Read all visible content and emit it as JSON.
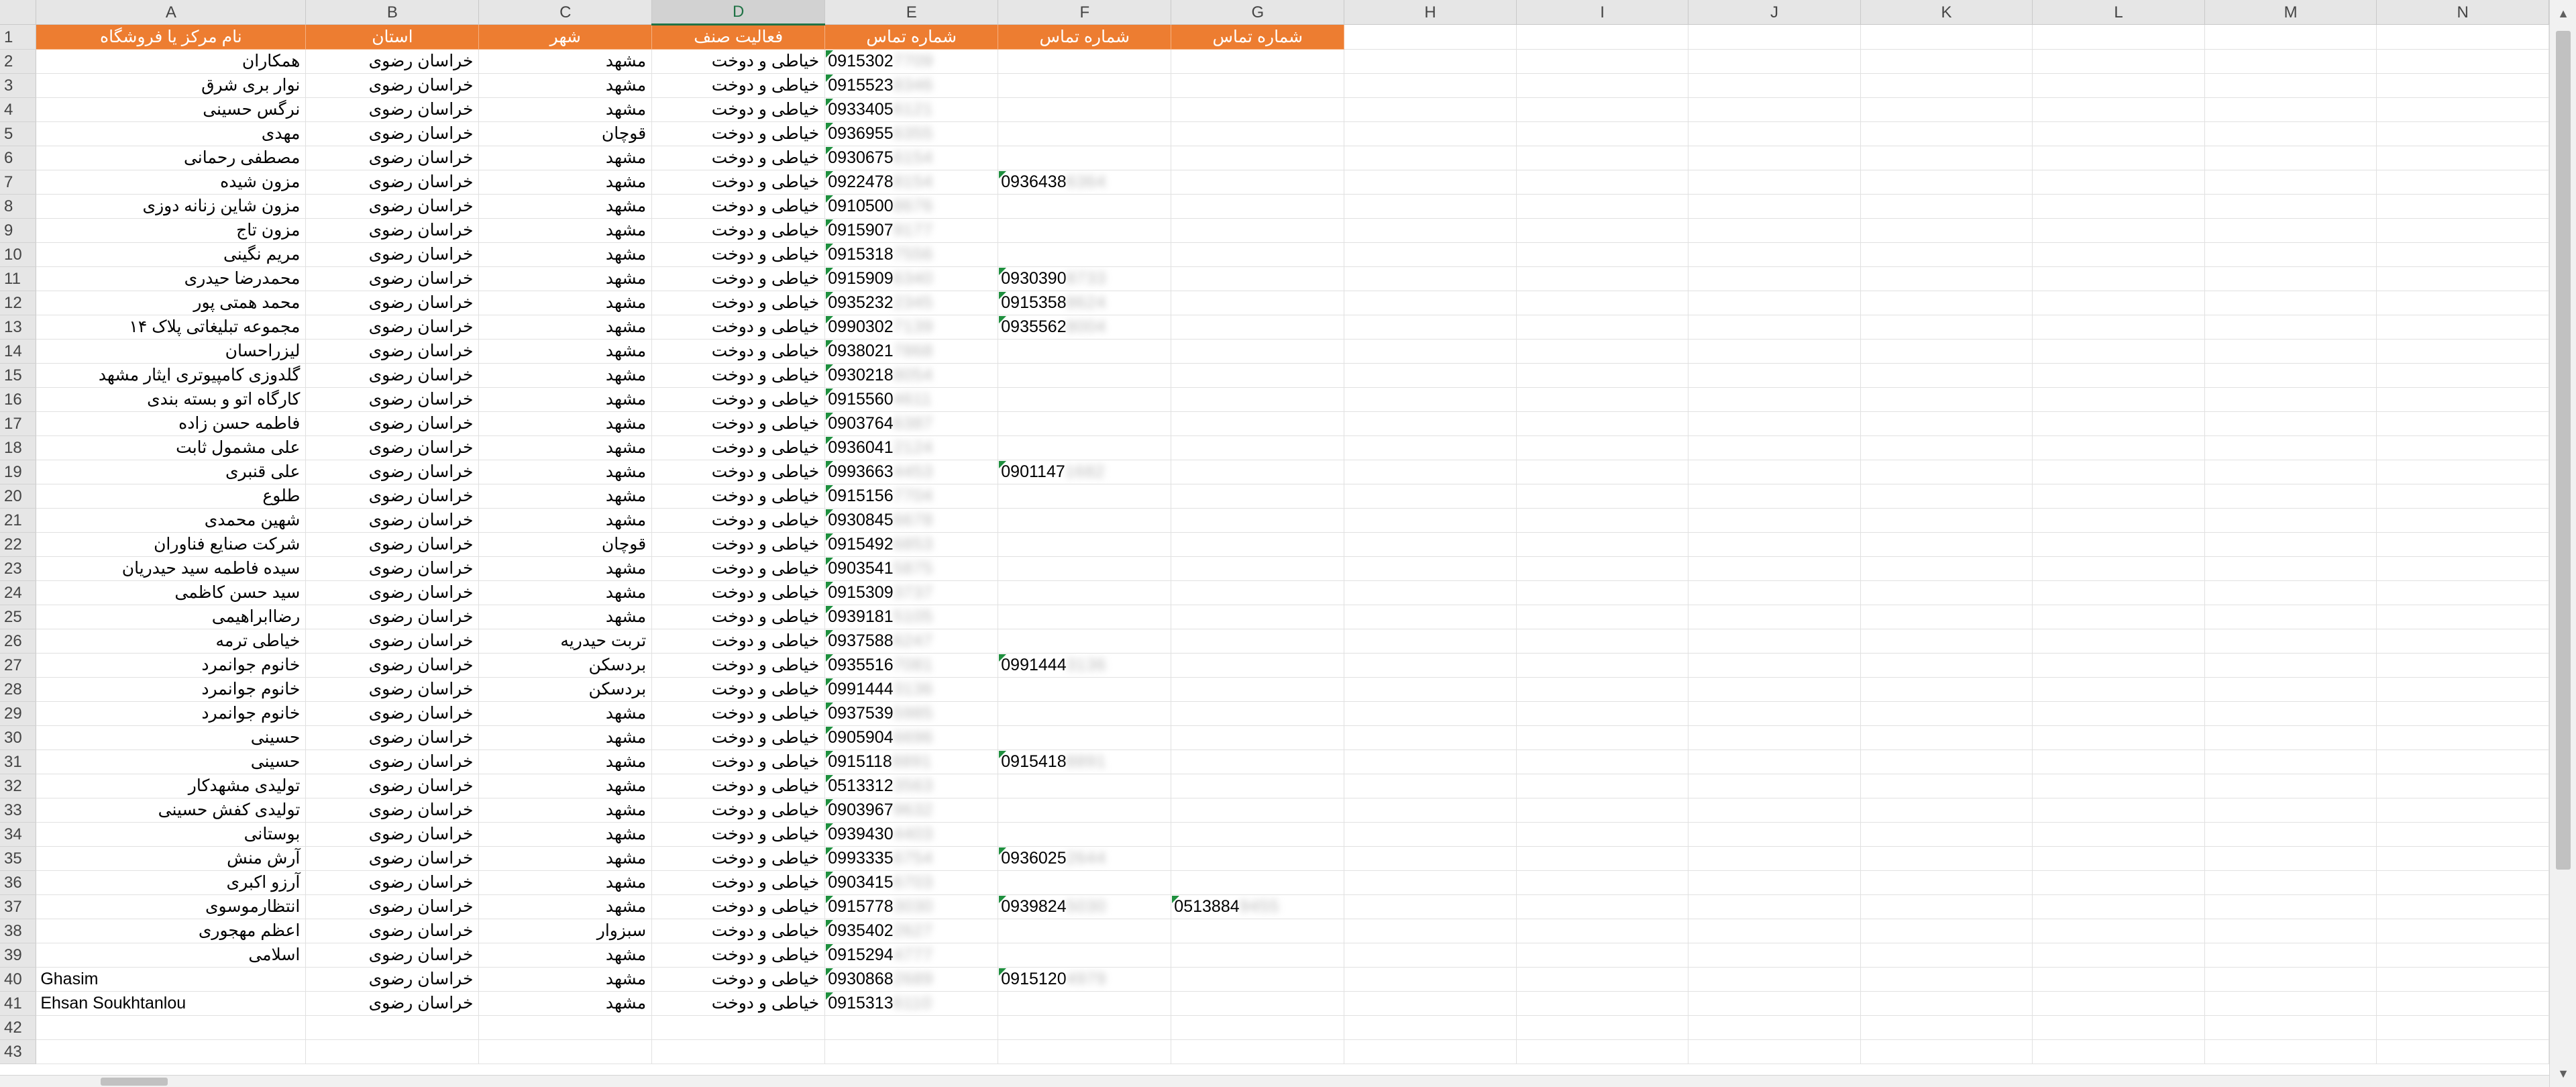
{
  "columns": [
    "A",
    "B",
    "C",
    "D",
    "E",
    "F",
    "G",
    "H",
    "I",
    "J",
    "K",
    "L",
    "M",
    "N"
  ],
  "selected_column": "D",
  "headers": {
    "A": "نام مرکز یا فروشگاه",
    "B": "استان",
    "C": "شهر",
    "D": "فعالیت صنف",
    "E": "شماره تماس",
    "F": "شماره تماس",
    "G": "شماره تماس"
  },
  "row_numbers": [
    "1",
    "2",
    "3",
    "4",
    "5",
    "6",
    "7",
    "8",
    "9",
    "10",
    "11",
    "12",
    "13",
    "14",
    "15",
    "16",
    "17",
    "18",
    "19",
    "20",
    "21",
    "22",
    "23",
    "24",
    "25",
    "26",
    "27",
    "28",
    "29",
    "30",
    "31",
    "32",
    "33",
    "34",
    "35",
    "36",
    "37",
    "38",
    "39",
    "40",
    "41",
    "42",
    "43"
  ],
  "rows": [
    {
      "name": "همکاران",
      "province": "خراسان رضوی",
      "city": "مشهد",
      "activity": "خیاطی و دوخت",
      "e": "0915302",
      "e_hidden": "7709",
      "f": "",
      "f_hidden": "",
      "g": "",
      "g_hidden": ""
    },
    {
      "name": "نوار بری شرق",
      "province": "خراسان رضوی",
      "city": "مشهد",
      "activity": "خیاطی و دوخت",
      "e": "0915523",
      "e_hidden": "8346",
      "f": "",
      "f_hidden": "",
      "g": "",
      "g_hidden": ""
    },
    {
      "name": "نرگس حسینی",
      "province": "خراسان رضوی",
      "city": "مشهد",
      "activity": "خیاطی و دوخت",
      "e": "0933405",
      "e_hidden": "6121",
      "f": "",
      "f_hidden": "",
      "g": "",
      "g_hidden": ""
    },
    {
      "name": "مهدی",
      "province": "خراسان رضوی",
      "city": "قوچان",
      "activity": "خیاطی و دوخت",
      "e": "0936955",
      "e_hidden": "6355",
      "f": "",
      "f_hidden": "",
      "g": "",
      "g_hidden": ""
    },
    {
      "name": "مصطفی رحمانی",
      "province": "خراسان رضوی",
      "city": "مشهد",
      "activity": "خیاطی و دوخت",
      "e": "0930675",
      "e_hidden": "6154",
      "f": "",
      "f_hidden": "",
      "g": "",
      "g_hidden": ""
    },
    {
      "name": "مزون شیده",
      "province": "خراسان رضوی",
      "city": "مشهد",
      "activity": "خیاطی و دوخت",
      "e": "0922478",
      "e_hidden": "8154",
      "f": "0936438",
      "f_hidden": "6364",
      "g": "",
      "g_hidden": ""
    },
    {
      "name": "مزون شاین زنانه دوزی",
      "province": "خراسان رضوی",
      "city": "مشهد",
      "activity": "خیاطی و دوخت",
      "e": "0910500",
      "e_hidden": "8676",
      "f": "",
      "f_hidden": "",
      "g": "",
      "g_hidden": ""
    },
    {
      "name": "مزون تاج",
      "province": "خراسان رضوی",
      "city": "مشهد",
      "activity": "خیاطی و دوخت",
      "e": "0915907",
      "e_hidden": "9177",
      "f": "",
      "f_hidden": "",
      "g": "",
      "g_hidden": ""
    },
    {
      "name": "مریم نگینی",
      "province": "خراسان رضوی",
      "city": "مشهد",
      "activity": "خیاطی و دوخت",
      "e": "0915318",
      "e_hidden": "7556",
      "f": "",
      "f_hidden": "",
      "g": "",
      "g_hidden": ""
    },
    {
      "name": "محمدرضا حیدری",
      "province": "خراسان رضوی",
      "city": "مشهد",
      "activity": "خیاطی و دوخت",
      "e": "0915909",
      "e_hidden": "6340",
      "f": "0930390",
      "f_hidden": "8733",
      "g": "",
      "g_hidden": ""
    },
    {
      "name": "محمد همتی پور",
      "province": "خراسان رضوی",
      "city": "مشهد",
      "activity": "خیاطی و دوخت",
      "e": "0935232",
      "e_hidden": "2345",
      "f": "0915358",
      "f_hidden": "8624",
      "g": "",
      "g_hidden": ""
    },
    {
      "name": "مجموعه تبلیغاتی پلاک ۱۴",
      "province": "خراسان رضوی",
      "city": "مشهد",
      "activity": "خیاطی و دوخت",
      "e": "0990302",
      "e_hidden": "7139",
      "f": "0935562",
      "f_hidden": "8004",
      "g": "",
      "g_hidden": ""
    },
    {
      "name": "لیزراحسان",
      "province": "خراسان رضوی",
      "city": "مشهد",
      "activity": "خیاطی و دوخت",
      "e": "0938021",
      "e_hidden": "7868",
      "f": "",
      "f_hidden": "",
      "g": "",
      "g_hidden": ""
    },
    {
      "name": "گلدوزی کامپیوتری ایثار مشهد",
      "province": "خراسان رضوی",
      "city": "مشهد",
      "activity": "خیاطی و دوخت",
      "e": "0930218",
      "e_hidden": "8054",
      "f": "",
      "f_hidden": "",
      "g": "",
      "g_hidden": ""
    },
    {
      "name": "کارگاه اتو و بسته بندی",
      "province": "خراسان رضوی",
      "city": "مشهد",
      "activity": "خیاطی و دوخت",
      "e": "0915560",
      "e_hidden": "4611",
      "f": "",
      "f_hidden": "",
      "g": "",
      "g_hidden": ""
    },
    {
      "name": "فاطمه حسن زاده",
      "province": "خراسان رضوی",
      "city": "مشهد",
      "activity": "خیاطی و دوخت",
      "e": "0903764",
      "e_hidden": "6387",
      "f": "",
      "f_hidden": "",
      "g": "",
      "g_hidden": ""
    },
    {
      "name": "علی مشمول ثابت",
      "province": "خراسان رضوی",
      "city": "مشهد",
      "activity": "خیاطی و دوخت",
      "e": "0936041",
      "e_hidden": "2124",
      "f": "",
      "f_hidden": "",
      "g": "",
      "g_hidden": ""
    },
    {
      "name": "علی قنبری",
      "province": "خراسان رضوی",
      "city": "مشهد",
      "activity": "خیاطی و دوخت",
      "e": "0993663",
      "e_hidden": "4453",
      "f": "0901147",
      "f_hidden": "1682",
      "g": "",
      "g_hidden": ""
    },
    {
      "name": "طلوع",
      "province": "خراسان رضوی",
      "city": "مشهد",
      "activity": "خیاطی و دوخت",
      "e": "0915156",
      "e_hidden": "7704",
      "f": "",
      "f_hidden": "",
      "g": "",
      "g_hidden": ""
    },
    {
      "name": "شهین محمدی",
      "province": "خراسان رضوی",
      "city": "مشهد",
      "activity": "خیاطی و دوخت",
      "e": "0930845",
      "e_hidden": "6678",
      "f": "",
      "f_hidden": "",
      "g": "",
      "g_hidden": ""
    },
    {
      "name": "شرکت صنایع فناوران",
      "province": "خراسان رضوی",
      "city": "قوچان",
      "activity": "خیاطی و دوخت",
      "e": "0915492",
      "e_hidden": "6853",
      "f": "",
      "f_hidden": "",
      "g": "",
      "g_hidden": ""
    },
    {
      "name": "سیده فاطمه سید حیدریان",
      "province": "خراسان رضوی",
      "city": "مشهد",
      "activity": "خیاطی و دوخت",
      "e": "0903541",
      "e_hidden": "5875",
      "f": "",
      "f_hidden": "",
      "g": "",
      "g_hidden": ""
    },
    {
      "name": "سید حسن کاظمی",
      "province": "خراسان رضوی",
      "city": "مشهد",
      "activity": "خیاطی و دوخت",
      "e": "0915309",
      "e_hidden": "3737",
      "f": "",
      "f_hidden": "",
      "g": "",
      "g_hidden": ""
    },
    {
      "name": "رضاابراهیمی",
      "province": "خراسان رضوی",
      "city": "مشهد",
      "activity": "خیاطی و دوخت",
      "e": "0939181",
      "e_hidden": "5105",
      "f": "",
      "f_hidden": "",
      "g": "",
      "g_hidden": ""
    },
    {
      "name": "خیاطی ترمه",
      "province": "خراسان رضوی",
      "city": "تربت حیدریه",
      "activity": "خیاطی و دوخت",
      "e": "0937588",
      "e_hidden": "6247",
      "f": "",
      "f_hidden": "",
      "g": "",
      "g_hidden": ""
    },
    {
      "name": "خانوم جوانمرد",
      "province": "خراسان رضوی",
      "city": "بردسکن",
      "activity": "خیاطی و دوخت",
      "e": "0935516",
      "e_hidden": "7081",
      "f": "0991444",
      "f_hidden": "3136",
      "g": "",
      "g_hidden": ""
    },
    {
      "name": "خانوم جوانمرد",
      "province": "خراسان رضوی",
      "city": "بردسکن",
      "activity": "خیاطی و دوخت",
      "e": "0991444",
      "e_hidden": "3136",
      "f": "",
      "f_hidden": "",
      "g": "",
      "g_hidden": ""
    },
    {
      "name": "خانوم جوانمرد",
      "province": "خراسان رضوی",
      "city": "مشهد",
      "activity": "خیاطی و دوخت",
      "e": "0937539",
      "e_hidden": "5985",
      "f": "",
      "f_hidden": "",
      "g": "",
      "g_hidden": ""
    },
    {
      "name": "حسینی",
      "province": "خراسان رضوی",
      "city": "مشهد",
      "activity": "خیاطی و دوخت",
      "e": "0905904",
      "e_hidden": "6696",
      "f": "",
      "f_hidden": "",
      "g": "",
      "g_hidden": ""
    },
    {
      "name": "حسینی",
      "province": "خراسان رضوی",
      "city": "مشهد",
      "activity": "خیاطی و دوخت",
      "e": "0915118",
      "e_hidden": "8891",
      "f": "0915418",
      "f_hidden": "8891",
      "g": "",
      "g_hidden": ""
    },
    {
      "name": "تولیدی مشهدکار",
      "province": "خراسان رضوی",
      "city": "مشهد",
      "activity": "خیاطی و دوخت",
      "e": "0513312",
      "e_hidden": "3563",
      "f": "",
      "f_hidden": "",
      "g": "",
      "g_hidden": ""
    },
    {
      "name": "تولیدی کفش حسینی",
      "province": "خراسان رضوی",
      "city": "مشهد",
      "activity": "خیاطی و دوخت",
      "e": "0903967",
      "e_hidden": "9632",
      "f": "",
      "f_hidden": "",
      "g": "",
      "g_hidden": ""
    },
    {
      "name": "بوستانی",
      "province": "خراسان رضوی",
      "city": "مشهد",
      "activity": "خیاطی و دوخت",
      "e": "0939430",
      "e_hidden": "4403",
      "f": "",
      "f_hidden": "",
      "g": "",
      "g_hidden": ""
    },
    {
      "name": "آرش منش",
      "province": "خراسان رضوی",
      "city": "مشهد",
      "activity": "خیاطی و دوخت",
      "e": "0993335",
      "e_hidden": "6754",
      "f": "0936025",
      "f_hidden": "2644",
      "g": "",
      "g_hidden": ""
    },
    {
      "name": "آرزو اکبری",
      "province": "خراسان رضوی",
      "city": "مشهد",
      "activity": "خیاطی و دوخت",
      "e": "0903415",
      "e_hidden": "6703",
      "f": "",
      "f_hidden": "",
      "g": "",
      "g_hidden": ""
    },
    {
      "name": "انتظارموسوی",
      "province": "خراسان رضوی",
      "city": "مشهد",
      "activity": "خیاطی و دوخت",
      "e": "0915778",
      "e_hidden": "3030",
      "f": "0939824",
      "f_hidden": "5030",
      "g": "0513884",
      "g_hidden": "9455"
    },
    {
      "name": "اعظم مهجوری",
      "province": "خراسان رضوی",
      "city": "سبزوار",
      "activity": "خیاطی و دوخت",
      "e": "0935402",
      "e_hidden": "2627",
      "f": "",
      "f_hidden": "",
      "g": "",
      "g_hidden": ""
    },
    {
      "name": "اسلامی",
      "province": "خراسان رضوی",
      "city": "مشهد",
      "activity": "خیاطی و دوخت",
      "e": "0915294",
      "e_hidden": "4777",
      "f": "",
      "f_hidden": "",
      "g": "",
      "g_hidden": ""
    },
    {
      "name": "Ghasim",
      "province": "خراسان رضوی",
      "city": "مشهد",
      "activity": "خیاطی و دوخت",
      "e": "0930868",
      "e_hidden": "2689",
      "f": "0915120",
      "f_hidden": "4979",
      "g": "",
      "g_hidden": ""
    },
    {
      "name": "Ehsan Soukhtanlou",
      "province": "خراسان رضوی",
      "city": "مشهد",
      "activity": "خیاطی و دوخت",
      "e": "0915313",
      "e_hidden": "6110",
      "f": "",
      "f_hidden": "",
      "g": "",
      "g_hidden": ""
    }
  ],
  "colors": {
    "header_fill": "#ed7d31",
    "header_text": "#ffffff",
    "number_flag": "#1e8f3e",
    "accent": "#217346"
  },
  "icons": {
    "scroll_up": "triangle-up-icon",
    "scroll_down": "triangle-down-icon"
  }
}
